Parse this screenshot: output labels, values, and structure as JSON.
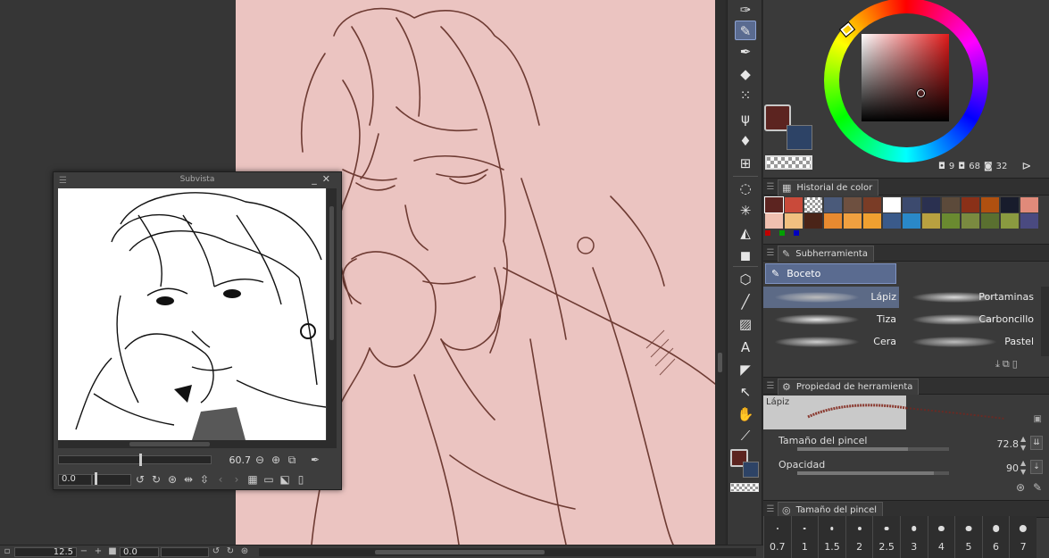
{
  "subview": {
    "title": "Subvista",
    "zoom": "60.7",
    "rotation": "0.0"
  },
  "statusbar": {
    "zoom": "12.5",
    "rotation": "0.0"
  },
  "color": {
    "main": "#5c2420",
    "sub": "#2d4366",
    "readout": {
      "h": "9",
      "s": "68",
      "v": "32"
    }
  },
  "color_history": {
    "tab_label": "Historial de color",
    "swatches": [
      "#5c2420",
      "#c94a3a",
      "checker",
      "#4a5a7a",
      "#6e5040",
      "#7a3c26",
      "#ffffff",
      "#3c4a6e",
      "#2a3050",
      "#5c4a3a",
      "#8a3018",
      "#b05010",
      "#181c2c",
      "#e08a7a",
      "#f0c0b0",
      "#f0c080",
      "#4a2418",
      "#e88a30",
      "#f0a040",
      "#f0a030",
      "#3a5a8a",
      "#2a88c8",
      "#b8a040",
      "#6a8a30",
      "#7a8a40",
      "#5a7030",
      "#8a9a40",
      "#4a4a80",
      "#30a8e0",
      "#f0a850"
    ],
    "mini": [
      "#c00000",
      "#00a000",
      "#0000c0"
    ]
  },
  "subtool": {
    "tab_label": "Subherramienta",
    "set_label": "Boceto",
    "brushes": [
      {
        "label": "Lápiz",
        "selected": true
      },
      {
        "label": "Portaminas"
      },
      {
        "label": "Tiza"
      },
      {
        "label": "Carboncillo"
      },
      {
        "label": "Cera"
      },
      {
        "label": "Pastel"
      }
    ]
  },
  "tool_property": {
    "tab_label": "Propiedad de herramienta",
    "preview_label": "Lápiz",
    "brush_size_label": "Tamaño del pincel",
    "brush_size_value": "72.8",
    "opacity_label": "Opacidad",
    "opacity_value": "90",
    "brush_size_fraction": 0.73,
    "opacity_fraction": 0.9
  },
  "brush_size_panel": {
    "tab_label": "Tamaño del pincel",
    "sizes": [
      "0.7",
      "1",
      "1.5",
      "2",
      "2.5",
      "3",
      "4",
      "5",
      "6",
      "7"
    ]
  },
  "tools": [
    "pen-nib-icon",
    "pen-icon",
    "marker-icon",
    "eraser-icon",
    "fill-bucket-icon",
    "brush-decoration-icon",
    "blend-drop-icon",
    "grid-ruler-icon",
    "lasso-select-icon",
    "magic-wand-icon",
    "paint-bucket-icon",
    "gradient-icon",
    "object-3d-icon",
    "line-icon",
    "hatch-icon",
    "text-icon",
    "balloon-icon",
    "corner-pick-icon",
    "hand-icon",
    "eyedropper-icon"
  ]
}
